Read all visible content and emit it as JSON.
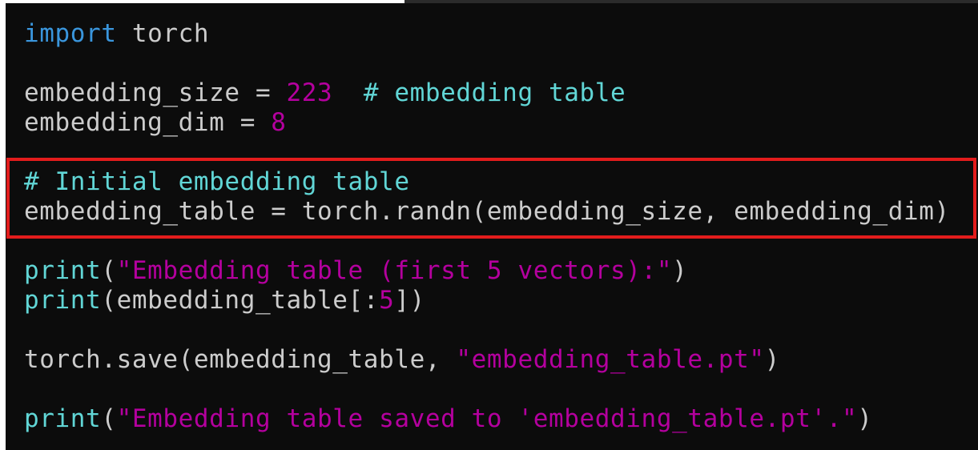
{
  "colors": {
    "background": "#0c0c0c",
    "default_text": "#cccccc",
    "keyword": "#3a96dd",
    "function_and_comment": "#61d6d6",
    "number_and_string": "#b4009e",
    "highlight_border": "#e31c1c"
  },
  "code": {
    "l1": {
      "kw": "import",
      "rest": " torch"
    },
    "l3": {
      "a": "embedding_size = ",
      "num": "223",
      "sp": "  ",
      "comment": "# embedding table"
    },
    "l4": {
      "a": "embedding_dim = ",
      "num": "8"
    },
    "l6": {
      "comment": "# Initial embedding table"
    },
    "l7": {
      "text": "embedding_table = torch.randn(embedding_size, embedding_dim)"
    },
    "l9": {
      "fn": "print",
      "open": "(",
      "str": "\"Embedding table (first 5 vectors):\"",
      "close": ")"
    },
    "l10": {
      "fn": "print",
      "a": "(embedding_table[:",
      "num": "5",
      "b": "])"
    },
    "l12": {
      "a": "torch.save(embedding_table, ",
      "str": "\"embedding_table.pt\"",
      "close": ")"
    },
    "l14": {
      "fn": "print",
      "open": "(",
      "str": "\"Embedding table saved to 'embedding_table.pt'.\"",
      "close": ")"
    }
  }
}
